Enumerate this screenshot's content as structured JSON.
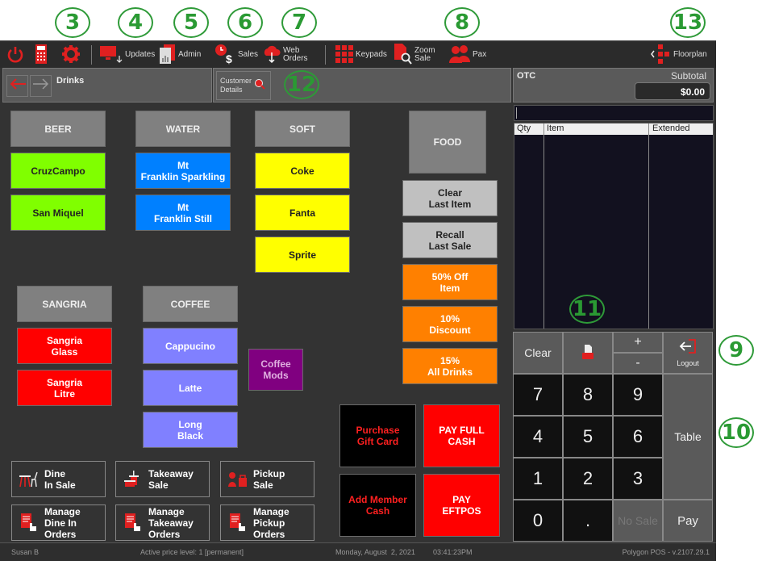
{
  "callouts": [
    "3",
    "4",
    "5",
    "6",
    "7",
    "8",
    "13",
    "12",
    "11",
    "9",
    "10"
  ],
  "toolbar": {
    "power": "power-icon",
    "calculator": "calculator-icon",
    "settings": "gear-icon",
    "updates": "Updates",
    "admin": "Admin",
    "sales": "Sales",
    "web_orders": "Web\nOrders",
    "keypads": "Keypads",
    "zoom_sale": "Zoom\nSale",
    "pax": "Pax",
    "floorplan": "Floorplan"
  },
  "nav": {
    "title": "Drinks",
    "customer_details": "Customer\nDetails"
  },
  "order": {
    "name": "OTC",
    "subtotal_label": "Subtotal",
    "subtotal_value": "$0.00",
    "columns": [
      "Qty",
      "Item",
      "Extended"
    ]
  },
  "categories": {
    "beer": "BEER",
    "water": "WATER",
    "soft": "SOFT",
    "food": "FOOD",
    "sangria": "SANGRIA",
    "coffee": "COFFEE"
  },
  "items": {
    "cruzcampo": "CruzCampo",
    "san_miquel": "San Miquel",
    "mt_sparkling": "Mt\nFranklin Sparkling",
    "mt_still": "Mt\nFranklin Still",
    "coke": "Coke",
    "fanta": "Fanta",
    "sprite": "Sprite",
    "sangria_glass": "Sangria\nGlass",
    "sangria_litre": "Sangria\nLitre",
    "cappucino": "Cappucino",
    "latte": "Latte",
    "long_black": "Long\nBlack",
    "coffee_mods": "Coffee\nMods"
  },
  "functions": {
    "clear_last": "Clear\nLast Item",
    "recall_last": "Recall\nLast Sale",
    "off50": "50% Off\nItem",
    "disc10": "10%\nDiscount",
    "all15": "15%\nAll Drinks",
    "gift": "Purchase\nGift Card",
    "member": "Add Member\nCash",
    "pay_cash": "PAY FULL\nCASH",
    "pay_eftpos": "PAY\nEFTPOS"
  },
  "modes": {
    "dine_in": "Dine\nIn Sale",
    "takeaway": "Takeaway\nSale",
    "pickup": "Pickup\nSale",
    "manage_dine": "Manage\nDine In\nOrders",
    "manage_take": "Manage\nTakeaway\nOrders",
    "manage_pick": "Manage\nPickup\nOrders"
  },
  "keypad": {
    "clear": "Clear",
    "plus": "+",
    "minus": "-",
    "logout": "Logout",
    "k7": "7",
    "k8": "8",
    "k9": "9",
    "k4": "4",
    "k5": "5",
    "k6": "6",
    "k1": "1",
    "k2": "2",
    "k3": "3",
    "k0": "0",
    "dot": ".",
    "table": "Table",
    "no_sale": "No Sale",
    "pay": "Pay"
  },
  "status": {
    "user": "Susan B",
    "price_level": "Active price level: 1 [permanent]",
    "date": "Monday, August  2, 2021",
    "time": "03:41:23PM",
    "version": "Polygon POS - v.2107.29.1"
  }
}
